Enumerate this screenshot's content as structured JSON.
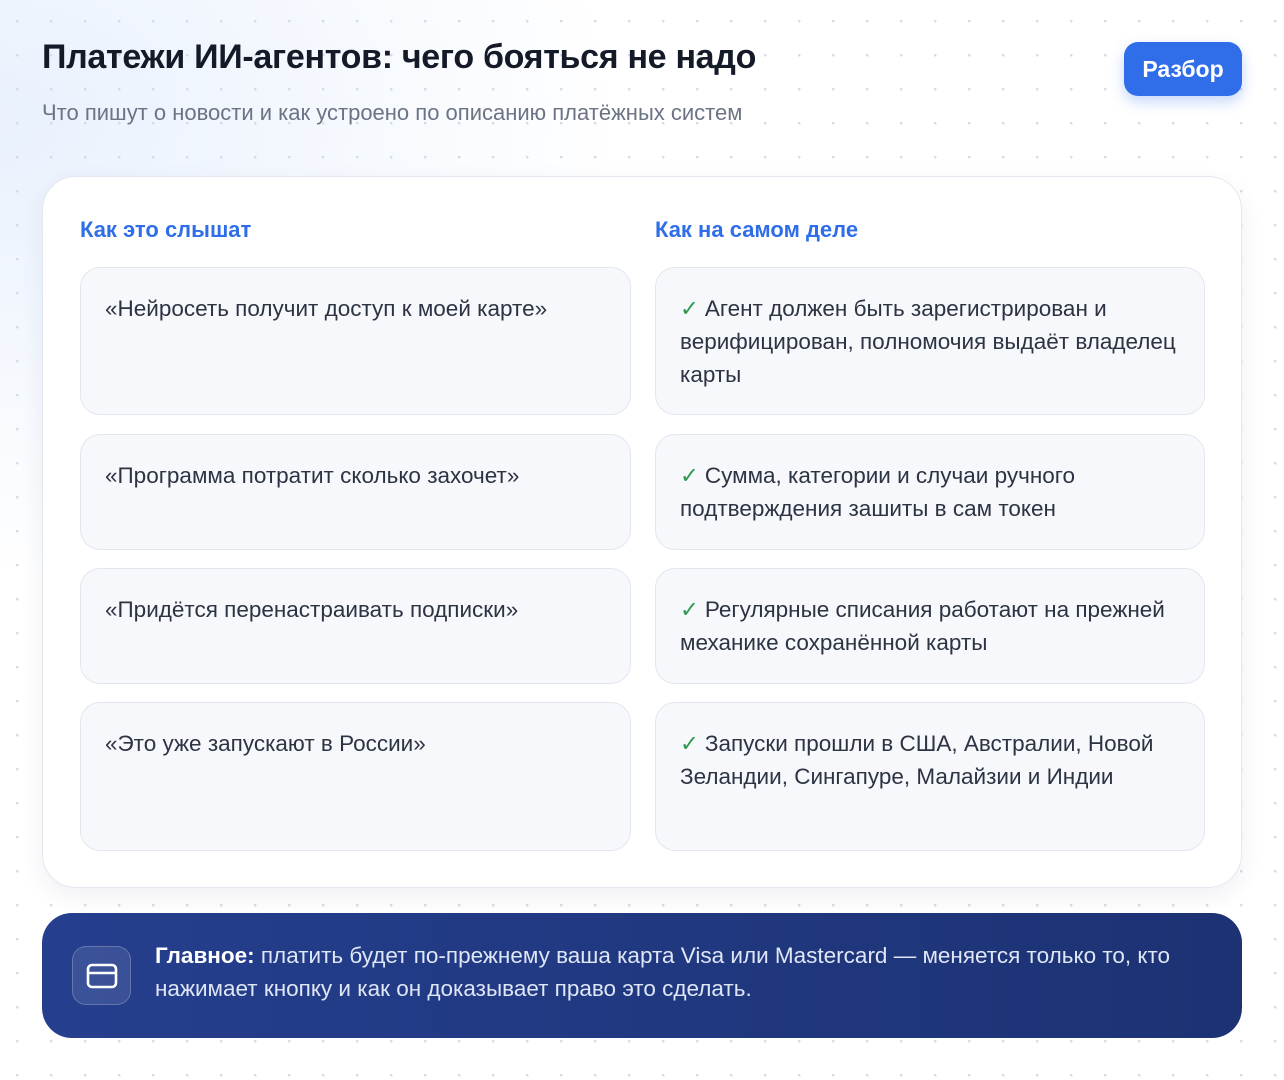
{
  "header": {
    "title": "Платежи ИИ-агентов: чего бояться не надо",
    "subtitle": "Что пишут о новости и как устроено по описанию платёжных систем",
    "badge_label": "Разбор"
  },
  "compare": {
    "left_heading": "Как это слышат",
    "right_heading": "Как на самом деле",
    "check_mark": "✓",
    "rows": [
      {
        "myth": "«Нейросеть получит доступ к моей карте»",
        "fact": "Агент должен быть зарегистрирован и верифицирован, полномочия выдаёт владелец карты"
      },
      {
        "myth": "«Программа потратит сколько захочет»",
        "fact": "Сумма, категории и случаи ручного подтверждения зашиты в сам токен"
      },
      {
        "myth": "«Придётся перенастраивать подписки»",
        "fact": "Регулярные списания работают на прежней механике сохранённой карты"
      },
      {
        "myth": "«Это уже запускают в России»",
        "fact": "Запуски прошли в США, Австралии, Новой Зеландии, Сингапуре, Малайзии и Индии"
      }
    ]
  },
  "summary": {
    "icon": "credit-card-icon",
    "lead": "Главное:",
    "text": " платить будет по-прежнему ваша карта Visa или Mastercard — меняется только то, кто нажимает кнопку и как он доказывает право это сделать."
  },
  "colors": {
    "accent": "#2f6ee8",
    "check": "#2e9a4d",
    "banner": "#1f3679"
  }
}
